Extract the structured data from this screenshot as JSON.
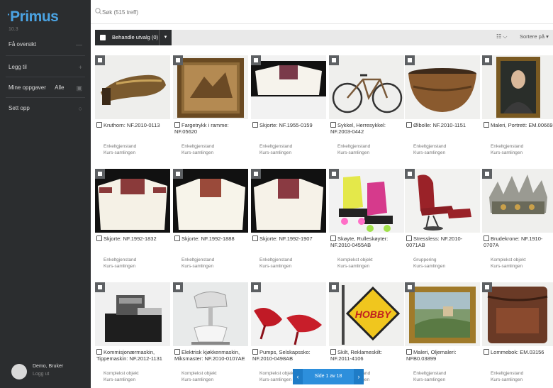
{
  "app": {
    "logo": "Primus",
    "version": "10.3"
  },
  "sidebar": {
    "items": [
      {
        "label": "Få oversikt",
        "icon": "collapse-icon"
      },
      {
        "label": "Legg til",
        "icon": "plus-icon"
      },
      {
        "label": "Mine oppgaver",
        "extra": "Alle",
        "icon": "tasks-icon"
      },
      {
        "label": "Sett opp",
        "icon": "settings-icon"
      }
    ],
    "user": {
      "name": "Demo, Bruker",
      "logout": "Logg ut"
    }
  },
  "search": {
    "placeholder": "Søk (515 treff)"
  },
  "toolbar": {
    "bulk_label": "Behandle utvalg (0)",
    "grid_toggle": "☷ ⌵",
    "sort_label": "Sortere på"
  },
  "cards": [
    {
      "title": "Kruthorn: NF.2010-0113",
      "type": "Enkeltgjenstand",
      "collection": "Kurs-samlingen",
      "image": "powder-horn"
    },
    {
      "title": "Fargetrykk i ramme: NF.05620",
      "type": "Enkeltgjenstand",
      "collection": "Kurs-samlingen",
      "image": "framed-print"
    },
    {
      "title": "Skjorte: NF.1955-0159",
      "type": "Enkeltgjenstand",
      "collection": "Kurs-samlingen",
      "image": "shirt"
    },
    {
      "title": "Sykkel, Herresykkel: NF.2003-0442",
      "type": "Enkeltgjenstand",
      "collection": "Kurs-samlingen",
      "image": "bicycle"
    },
    {
      "title": "Ølbolle: NF.2010-1151",
      "type": "Enkeltgjenstand",
      "collection": "Kurs-samlingen",
      "image": "bowl"
    },
    {
      "title": "Maleri, Portrett: EM.00669",
      "type": "Enkeltgjenstand",
      "collection": "Kurs-samlingen",
      "image": "portrait"
    },
    {
      "title": "Skjorte: NF.1992-1832",
      "type": "Enkeltgjenstand",
      "collection": "Kurs-samlingen",
      "image": "shirt"
    },
    {
      "title": "Skjorte: NF.1992-1888",
      "type": "Enkeltgjenstand",
      "collection": "Kurs-samlingen",
      "image": "shirt"
    },
    {
      "title": "Skjorte: NF.1992-1907",
      "type": "Enkeltgjenstand",
      "collection": "Kurs-samlingen",
      "image": "shirt"
    },
    {
      "title": "Skøyte, Rulleskøyter: NF.2010-0455AB",
      "type": "Komplekst objekt",
      "collection": "Kurs-samlingen",
      "image": "roller-skates"
    },
    {
      "title": "Stressless: NF.2010-0071AB",
      "type": "Gruppering",
      "collection": "Kurs-samlingen",
      "image": "chair"
    },
    {
      "title": "Brudekrone: NF.1910-0707A",
      "type": "Komplekst objekt",
      "collection": "Kurs-samlingen",
      "image": "crown"
    },
    {
      "title": "Kommisjonærmaskin, Tippemaskin: NF.2012-1131",
      "type": "Komplekst objekt",
      "collection": "Kurs-samlingen",
      "image": "machine"
    },
    {
      "title": "Elektrisk kjøkkenmaskin, Miksmaster: NF.2010-0107AE",
      "type": "Komplekst objekt",
      "collection": "Kurs-samlingen",
      "image": "mixer"
    },
    {
      "title": "Pumps, Selskapssko: NF.2010-0498AB",
      "type": "Komplekst objekt",
      "collection": "Kurs-samlingen",
      "image": "shoes"
    },
    {
      "title": "Skilt, Reklameskilt: NF.2011-4106",
      "type": "Enkeltgjenstand",
      "collection": "Kurs-samlingen",
      "image": "sign"
    },
    {
      "title": "Maleri, Oljemaleri: NFB0.03899",
      "type": "Enkeltgjenstand",
      "collection": "Kurs-samlingen",
      "image": "landscape"
    },
    {
      "title": "Lommebok: EM.03156",
      "type": "Enkeltgjenstand",
      "collection": "Kurs-samlingen",
      "image": "wallet"
    }
  ],
  "sign_text": "HOBBY",
  "pager": {
    "label": "Side 1 av 18",
    "prev": "‹",
    "next": "›"
  }
}
